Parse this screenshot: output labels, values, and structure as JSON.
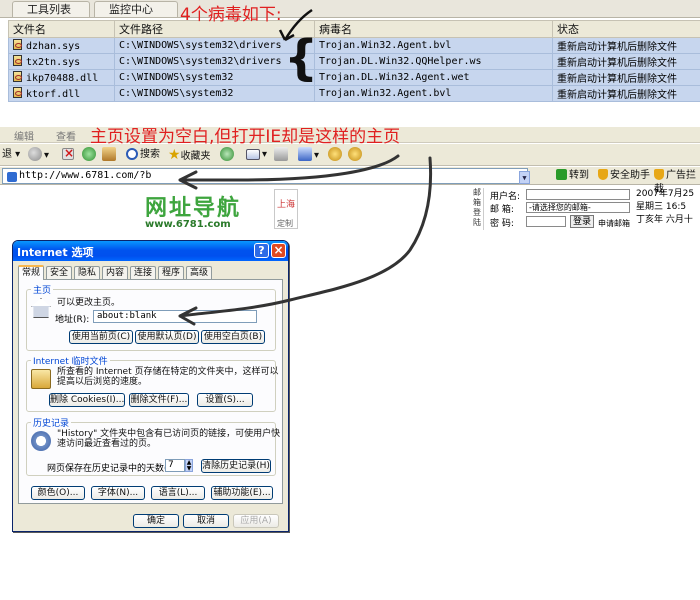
{
  "tool_tabs": [
    "工具列表",
    "监控中心"
  ],
  "annotations": {
    "title": "4个病毒如下:",
    "homepage": "主页设置为空白,但打开IE却是这样的主页"
  },
  "virus_table": {
    "headers": [
      "文件名",
      "文件路径",
      "病毒名",
      "状态"
    ],
    "rows": [
      {
        "file": "dzhan.sys",
        "path": "C:\\WINDOWS\\system32\\drivers",
        "virus": "Trojan.Win32.Agent.bvl",
        "status": "重新启动计算机后删除文件"
      },
      {
        "file": "tx2tn.sys",
        "path": "C:\\WINDOWS\\system32\\drivers",
        "virus": "Trojan.DL.Win32.QQHelper.ws",
        "status": "重新启动计算机后删除文件"
      },
      {
        "file": "ikp70488.dll",
        "path": "C:\\WINDOWS\\system32",
        "virus": "Trojan.DL.Win32.Agent.wet",
        "status": "重新启动计算机后删除文件"
      },
      {
        "file": "ktorf.dll",
        "path": "C:\\WINDOWS\\system32",
        "virus": "Trojan.Win32.Agent.bvl",
        "status": "重新启动计算机后删除文件"
      }
    ]
  },
  "ie": {
    "menu": [
      "编辑",
      "查看"
    ],
    "toolbar": {
      "back": "退",
      "search": "搜索",
      "favorites": "收藏夹"
    },
    "address_url": "http://www.6781.com/?b",
    "go": "转到",
    "safety": "安全助手",
    "adblock": "广告拦截"
  },
  "webpage": {
    "logo_cn": "网址导航",
    "logo_url": "www.6781.com",
    "city": "上海",
    "city_setting": "定制",
    "mail_vertical": [
      "邮",
      "箱",
      "登",
      "陆"
    ],
    "username_label": "用户名:",
    "mailbox_label": "邮 箱:",
    "mailbox_select": "-请选择您的邮箱-",
    "password_label": "密 码:",
    "login": "登录",
    "register": "申请邮箱",
    "date_line": "2007年7月25",
    "week_line": "星期三 16:5",
    "lunar_line": "丁亥年 六月十"
  },
  "dialog": {
    "title": "Internet 选项",
    "tabs": [
      "常规",
      "安全",
      "隐私",
      "内容",
      "连接",
      "程序",
      "高级"
    ],
    "home": {
      "title": "主页",
      "desc": "可以更改主页。",
      "address_label": "地址(R):",
      "address_value": "about:blank",
      "btn_current": "使用当前页(C)",
      "btn_default": "使用默认页(D)",
      "btn_blank": "使用空白页(B)"
    },
    "temp": {
      "title": "Internet 临时文件",
      "desc1": "所查看的 Internet 页存储在特定的文件夹中，这样可以",
      "desc2": "提高以后浏览的速度。",
      "btn_cookies": "删除 Cookies(I)...",
      "btn_files": "删除文件(F)...",
      "btn_settings": "设置(S)..."
    },
    "history": {
      "title": "历史记录",
      "desc1": "\"History\" 文件夹中包含有已访问页的链接，可使用户快",
      "desc2": "速访问最近查看过的页。",
      "days_label": "网页保存在历史记录中的天数(K):",
      "days_value": "7",
      "btn_clear": "清除历史记录(H)"
    },
    "bottom_buttons": [
      "颜色(O)...",
      "字体(N)...",
      "语言(L)...",
      "辅助功能(E)..."
    ],
    "ok": "确定",
    "cancel": "取消",
    "apply": "应用(A)"
  }
}
